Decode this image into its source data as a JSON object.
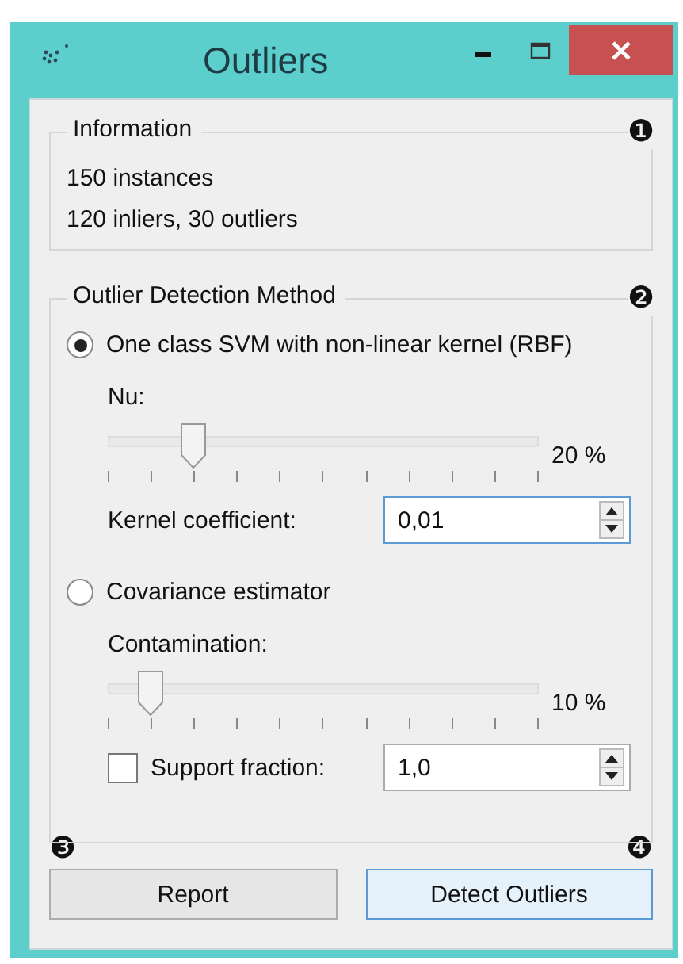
{
  "window": {
    "title": "Outliers"
  },
  "info": {
    "title": "Information",
    "badge": "❶",
    "lines": [
      "150 instances",
      "120 inliers, 30 outliers"
    ]
  },
  "method": {
    "title": "Outlier Detection Method",
    "badge": "❷",
    "options": [
      {
        "label": "One class SVM with non-linear kernel (RBF)",
        "selected": true,
        "slider": {
          "label": "Nu:",
          "level": 0.2,
          "reading": "20 %"
        },
        "field": {
          "kind": "plain",
          "label": "Kernel coefficient:",
          "value": "0,01",
          "focused": true
        }
      },
      {
        "label": "Covariance estimator",
        "selected": false,
        "slider": {
          "label": "Contamination:",
          "level": 0.1,
          "reading": "10 %"
        },
        "field": {
          "kind": "checkbox",
          "label": "Support fraction:",
          "checked": false,
          "value": "1,0",
          "focused": false
        }
      }
    ]
  },
  "footer": {
    "badges": [
      "❸",
      "❹"
    ],
    "buttons": [
      {
        "label": "Report",
        "focused": false
      },
      {
        "label": "Detect Outliers",
        "focused": true
      }
    ]
  }
}
